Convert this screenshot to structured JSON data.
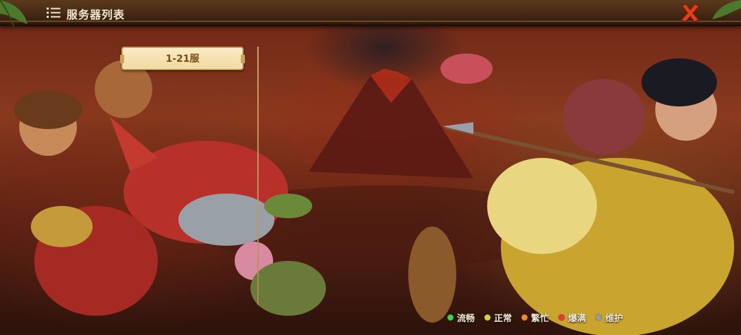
{
  "header": {
    "title": "服务器列表",
    "menu_icon": "list-icon",
    "close_icon": "close-x-icon"
  },
  "server_tabs": [
    {
      "label": "1-21服",
      "selected": true
    }
  ],
  "legend": [
    {
      "label": "流畅",
      "color": "#3fd14a"
    },
    {
      "label": "正常",
      "color": "#d9d03a"
    },
    {
      "label": "繁忙",
      "color": "#f08a22"
    },
    {
      "label": "爆满",
      "color": "#e53a3a"
    },
    {
      "label": "维护",
      "color": "#9a9a9a"
    }
  ],
  "colors": {
    "tab_bg": "#f6e3b2",
    "tab_text": "#7a4a1a",
    "header_wood": "#4a2c14",
    "close_red": "#e0401c"
  }
}
